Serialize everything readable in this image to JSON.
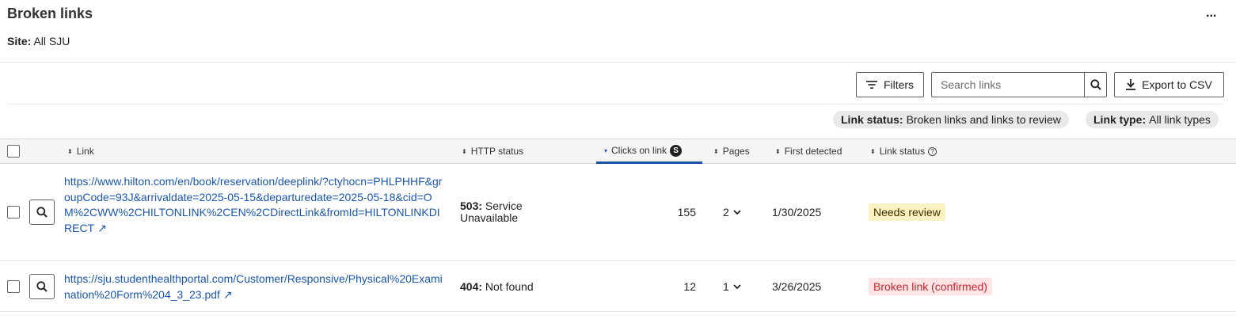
{
  "header": {
    "title": "Broken links",
    "more_label": "...",
    "site_label": "Site:",
    "site_value": "All SJU"
  },
  "toolbar": {
    "filters_label": "Filters",
    "search_placeholder": "Search links",
    "export_label": "Export to CSV"
  },
  "chips": [
    {
      "label": "Link status:",
      "value": "Broken links and links to review"
    },
    {
      "label": "Link type:",
      "value": "All link types"
    }
  ],
  "table": {
    "columns": {
      "link": "Link",
      "http_status": "HTTP status",
      "clicks": "Clicks on link",
      "clicks_badge": "S",
      "pages": "Pages",
      "first_detected": "First detected",
      "link_status": "Link status"
    },
    "rows": [
      {
        "url": "https://www.hilton.com/en/book/reservation/deeplink/?ctyhocn=PHLPHHF&groupCode=93J&arrivaldate=2025-05-15&departuredate=2025-05-18&cid=OM%2CWW%2CHILTONLINK%2CEN%2CDirectLink&fromId=HILTONLINKDIRECT",
        "status_code": "503:",
        "status_text": "Service Unavailable",
        "clicks": "155",
        "pages": "2",
        "first_detected": "1/30/2025",
        "link_status": "Needs review"
      },
      {
        "url": "https://sju.studenthealthportal.com/Customer/Responsive/Physical%20Examination%20Form%204_3_23.pdf",
        "status_code": "404:",
        "status_text": "Not found",
        "clicks": "12",
        "pages": "1",
        "first_detected": "3/26/2025",
        "link_status": "Broken link (confirmed)"
      }
    ]
  },
  "colors": {
    "link": "#1a56b0",
    "active_sort": "#1a56a8",
    "review_bg": "#fcf1c0",
    "broken_bg": "#fde3e3",
    "broken_text": "#c3262f"
  }
}
